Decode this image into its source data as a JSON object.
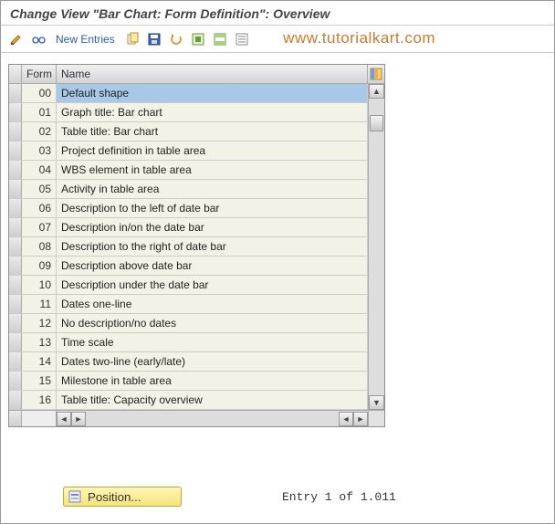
{
  "title": "Change View \"Bar Chart: Form Definition\": Overview",
  "toolbar": {
    "new_entries": "New Entries"
  },
  "watermark": "www.tutorialkart.com",
  "grid": {
    "headers": {
      "form": "Form",
      "name": "Name"
    },
    "rows": [
      {
        "form": "00",
        "name": "Default shape"
      },
      {
        "form": "01",
        "name": "Graph title: Bar chart"
      },
      {
        "form": "02",
        "name": "Table title: Bar chart"
      },
      {
        "form": "03",
        "name": "Project definition in table area"
      },
      {
        "form": "04",
        "name": "WBS element in table area"
      },
      {
        "form": "05",
        "name": "Activity in table area"
      },
      {
        "form": "06",
        "name": "Description to the left of date bar"
      },
      {
        "form": "07",
        "name": "Description in/on the date bar"
      },
      {
        "form": "08",
        "name": "Description to the right of date bar"
      },
      {
        "form": "09",
        "name": "Description above date bar"
      },
      {
        "form": "10",
        "name": "Description under the date bar"
      },
      {
        "form": "11",
        "name": "Dates one-line"
      },
      {
        "form": "12",
        "name": "No description/no dates"
      },
      {
        "form": "13",
        "name": "Time scale"
      },
      {
        "form": "14",
        "name": "Dates two-line (early/late)"
      },
      {
        "form": "15",
        "name": "Milestone in table area"
      },
      {
        "form": "16",
        "name": "Table title: Capacity overview"
      }
    ]
  },
  "footer": {
    "position_label": "Position...",
    "entry_status": "Entry 1 of 1.011"
  }
}
